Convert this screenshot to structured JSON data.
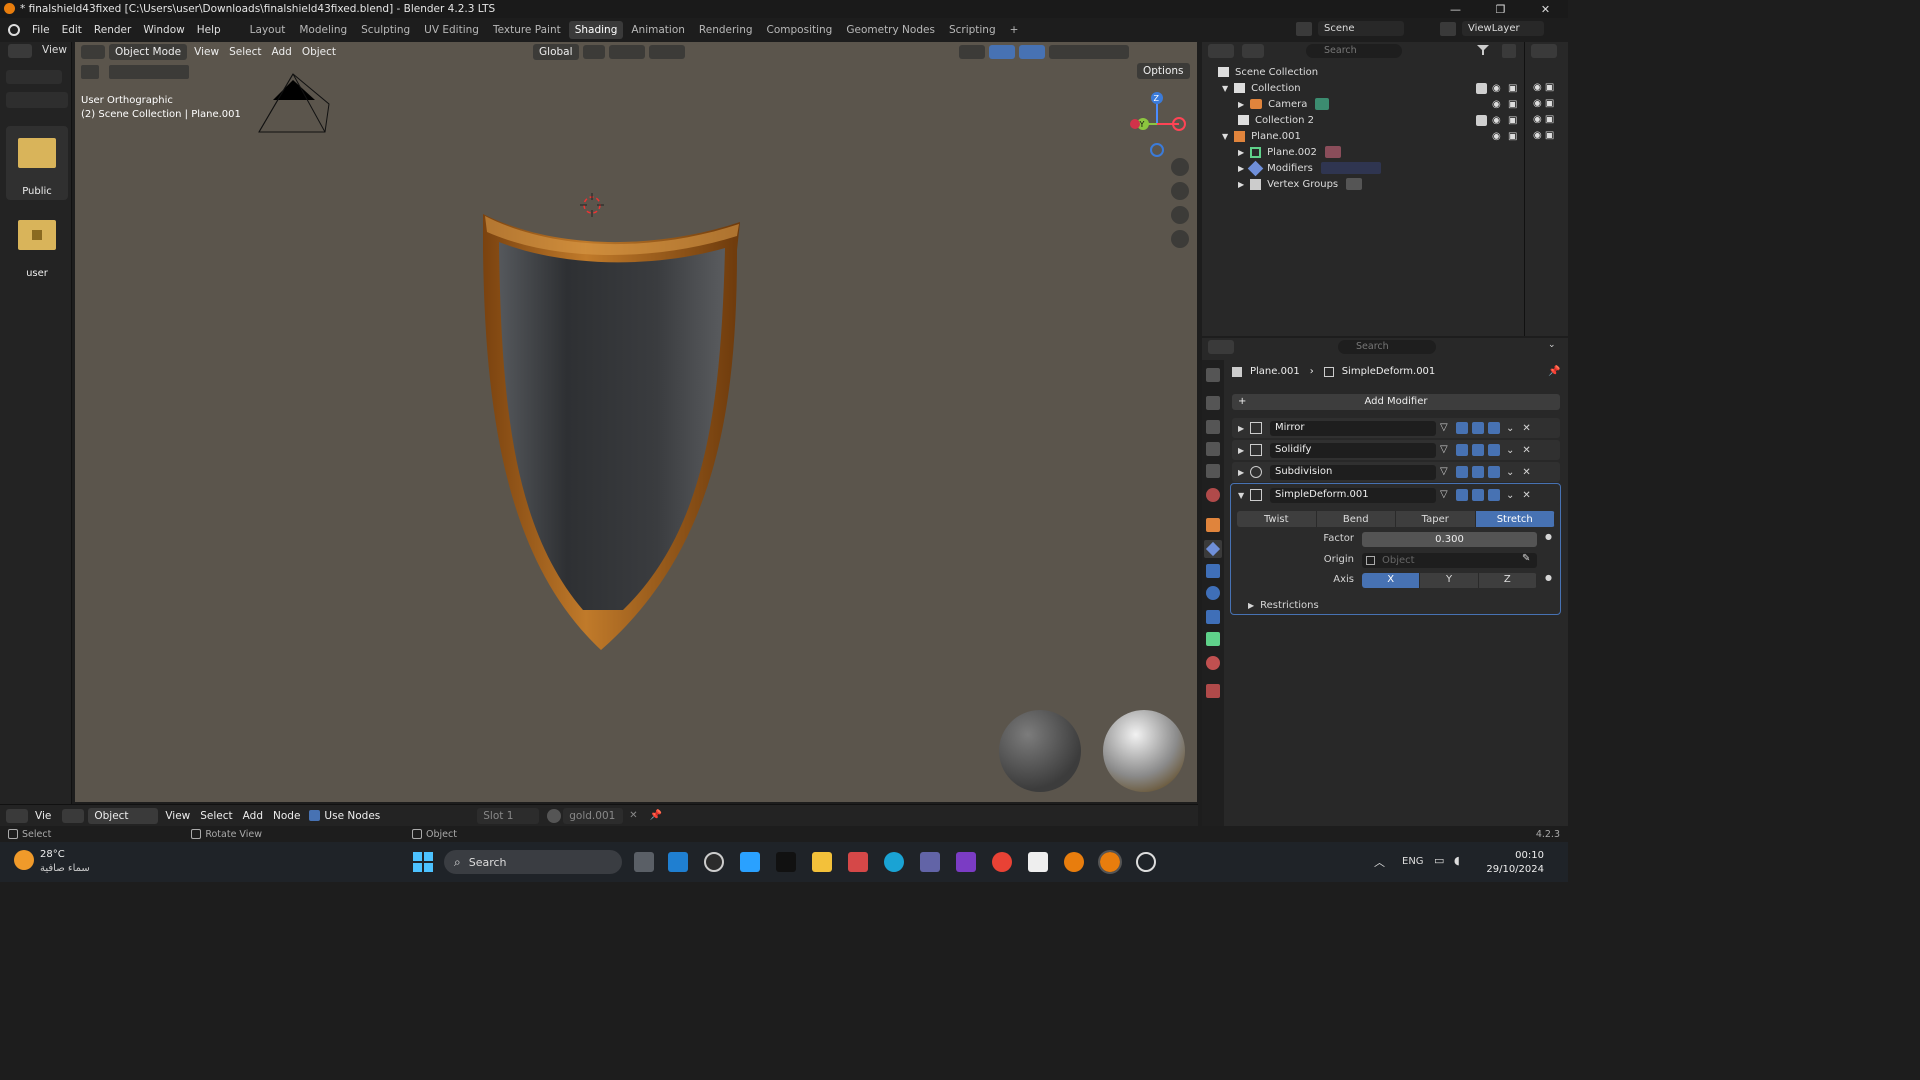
{
  "window": {
    "title": "* finalshield43fixed [C:\\Users\\user\\Downloads\\finalshield43fixed.blend] - Blender 4.2.3 LTS",
    "minimize": "—",
    "maximize": "❐",
    "close": "✕"
  },
  "menu": [
    "File",
    "Edit",
    "Render",
    "Window",
    "Help"
  ],
  "workspaces": [
    "Layout",
    "Modeling",
    "Sculpting",
    "UV Editing",
    "Texture Paint",
    "Shading",
    "Animation",
    "Rendering",
    "Compositing",
    "Geometry Nodes",
    "Scripting"
  ],
  "active_workspace": "Shading",
  "scene": {
    "name": "Scene",
    "view_layer": "ViewLayer"
  },
  "file_browser": {
    "view_label": "View",
    "items": [
      {
        "label": "Public"
      },
      {
        "label": "user"
      }
    ]
  },
  "viewport": {
    "mode": "Object Mode",
    "menus": [
      "View",
      "Select",
      "Add",
      "Object"
    ],
    "transform": "Global",
    "options": "Options",
    "view_name": "User Orthographic",
    "context": "(2) Scene Collection | Plane.001",
    "gizmo": {
      "z": "Z",
      "y": "Y"
    }
  },
  "outliner": {
    "search_placeholder": "Search",
    "root": "Scene Collection",
    "items": [
      {
        "label": "Collection"
      },
      {
        "label": "Camera"
      },
      {
        "label": "Collection 2"
      },
      {
        "label": "Plane.001"
      },
      {
        "label": "Plane.002"
      },
      {
        "label": "Modifiers"
      },
      {
        "label": "Vertex Groups"
      }
    ]
  },
  "properties": {
    "search_placeholder": "Search",
    "breadcrumb_object": "Plane.001",
    "breadcrumb_modifier": "SimpleDeform.001",
    "add_modifier": "Add Modifier",
    "modifiers": [
      "Mirror",
      "Solidify",
      "Subdivision",
      "SimpleDeform.001"
    ],
    "deform_modes": [
      "Twist",
      "Bend",
      "Taper",
      "Stretch"
    ],
    "active_mode": "Stretch",
    "factor_label": "Factor",
    "factor_value": "0.300",
    "origin_label": "Origin",
    "origin_placeholder": "Object",
    "axis_label": "Axis",
    "axes": [
      "X",
      "Y",
      "Z"
    ],
    "active_axis": "X",
    "restrictions": "Restrictions"
  },
  "node_editor": {
    "view": "Vie",
    "object": "Object",
    "menus": [
      "View",
      "Select",
      "Add",
      "Node"
    ],
    "use_nodes": "Use Nodes",
    "slot": "Slot 1",
    "material": "gold.001"
  },
  "status": {
    "select": "Select",
    "rotate": "Rotate View",
    "object": "Object",
    "version": "4.2.3"
  },
  "taskbar": {
    "weather_temp": "28°C",
    "weather_desc": "سماء صافية",
    "search": "Search",
    "lang": "ENG",
    "time": "00:10",
    "date": "29/10/2024"
  },
  "colors": {
    "accent": "#4772b3",
    "viewport_bg": "#5b554c",
    "shield_gold": "#a8621c",
    "shield_metal": "#3c3e40"
  }
}
